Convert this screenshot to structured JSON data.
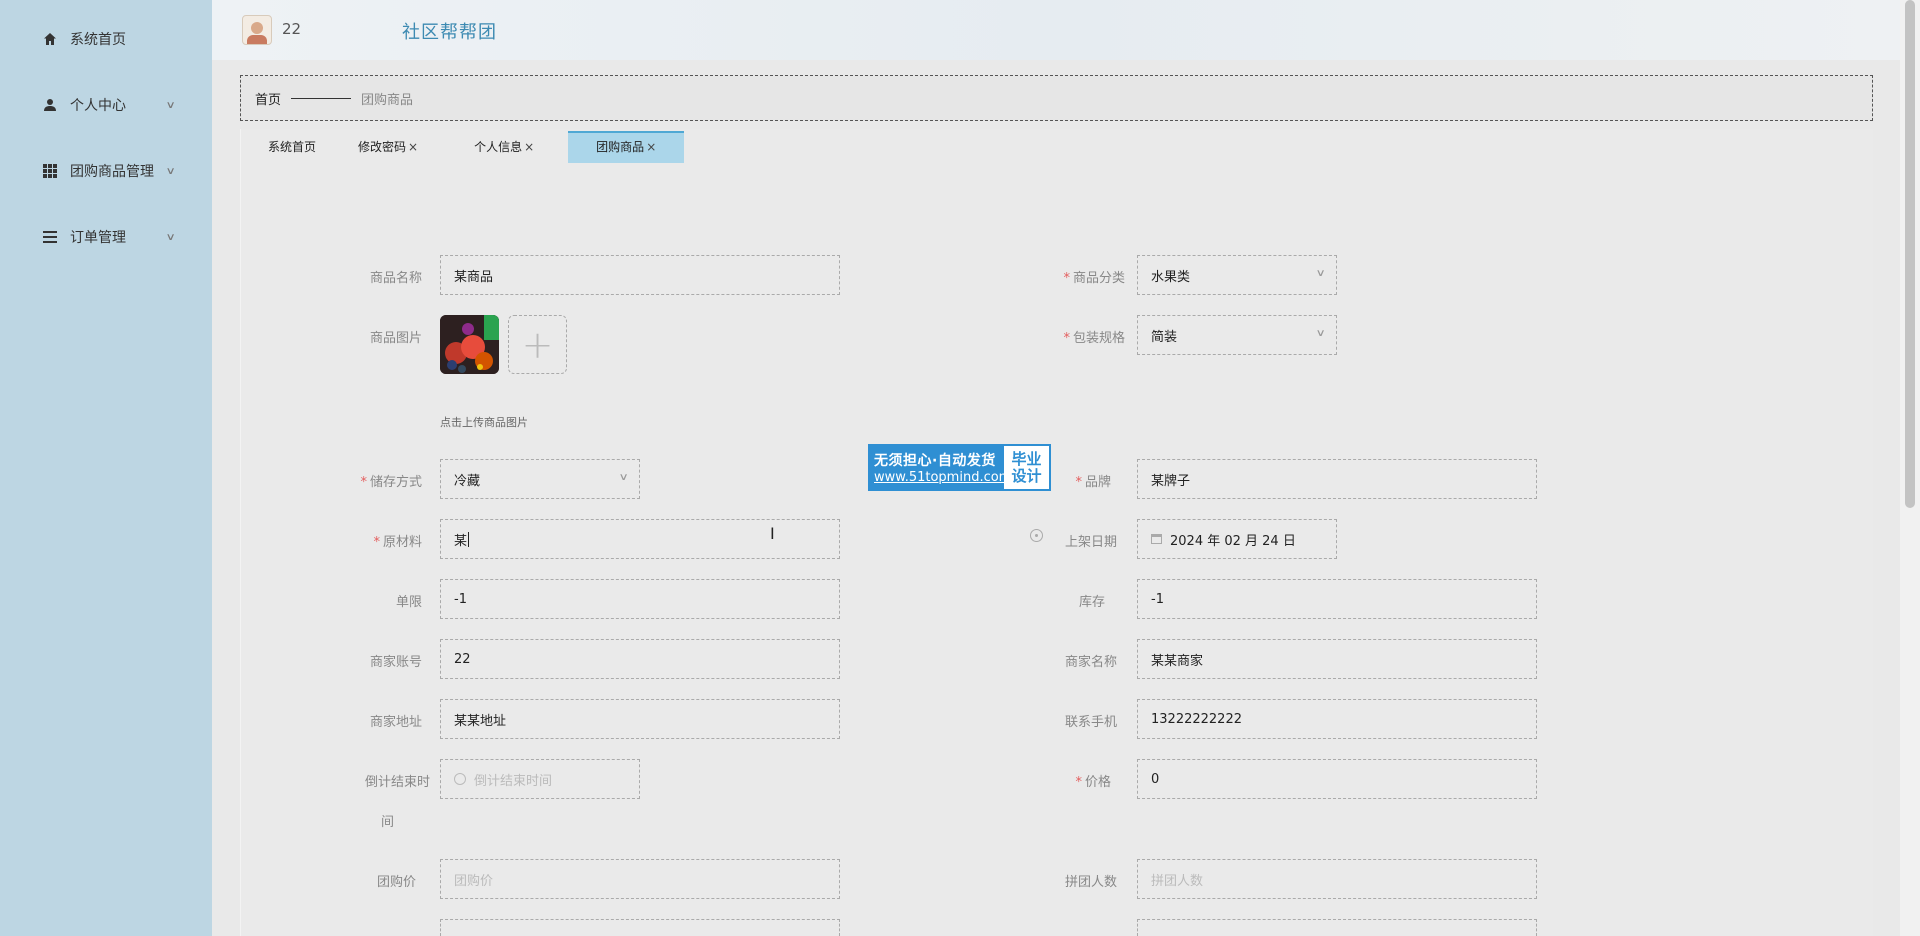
{
  "sidebar": {
    "items": [
      {
        "label": "系统首页",
        "icon": "home-icon"
      },
      {
        "label": "个人中心",
        "icon": "user-icon"
      },
      {
        "label": "团购商品管理",
        "icon": "grid-icon"
      },
      {
        "label": "订单管理",
        "icon": "list-icon"
      }
    ]
  },
  "header": {
    "user": "22",
    "title": "社区帮帮团"
  },
  "breadcrumb": {
    "home": "首页",
    "current": "团购商品"
  },
  "tabs": [
    {
      "label": "系统首页",
      "closable": false
    },
    {
      "label": "修改密码",
      "closable": true
    },
    {
      "label": "个人信息",
      "closable": true
    },
    {
      "label": "团购商品",
      "closable": true,
      "active": true
    }
  ],
  "tab_close": "×",
  "form": {
    "name": {
      "label": "商品名称",
      "value": "某商品"
    },
    "category": {
      "label": "商品分类",
      "value": "水果类"
    },
    "image": {
      "label": "商品图片",
      "hint": "点击上传商品图片",
      "upload": "+"
    },
    "pack": {
      "label": "包装规格",
      "value": "简装"
    },
    "storage": {
      "label": "储存方式",
      "value": "冷藏"
    },
    "brand": {
      "label": "品牌",
      "value": "某牌子"
    },
    "material": {
      "label": "原材料",
      "value": "某"
    },
    "shelf_date": {
      "label": "上架日期",
      "value": "2024 年 02 月 24 日"
    },
    "limit": {
      "label": "单限",
      "value": "-1"
    },
    "stock": {
      "label": "库存",
      "value": "-1"
    },
    "merchant_account": {
      "label": "商家账号",
      "value": "22"
    },
    "merchant_name": {
      "label": "商家名称",
      "value": "某某商家"
    },
    "merchant_addr": {
      "label": "商家地址",
      "value": "某某地址"
    },
    "phone": {
      "label": "联系手机",
      "value": "13222222222"
    },
    "countdown": {
      "label_1": "倒计结束时",
      "label_2": "间",
      "placeholder": "倒计结束时间"
    },
    "price": {
      "label": "价格",
      "value": "0"
    },
    "group_price": {
      "label": "团购价",
      "placeholder": "团购价"
    },
    "group_size": {
      "label": "拼团人数",
      "placeholder": "拼团人数"
    }
  },
  "watermark": {
    "line1": "无须担心·自动发货",
    "url": "www.51topmind.com",
    "badge_1": "毕业",
    "badge_2": "设计"
  },
  "colors": {
    "sidebar": "#bdd6e3",
    "accent": "#3d8ab2",
    "active_tab": "#abd6ea",
    "required": "#e35d5d"
  }
}
